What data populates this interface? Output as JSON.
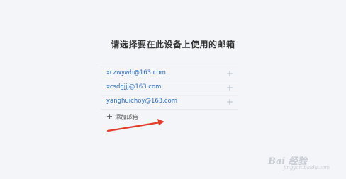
{
  "title": "请选择要在此设备上使用的邮箱",
  "accounts": [
    {
      "email": "xczwywh@163.com",
      "add_icon": "+"
    },
    {
      "email": "xcsdgjjj@163.com",
      "add_icon": "+"
    },
    {
      "email": "yanghuichoy@163.com",
      "add_icon": "+"
    }
  ],
  "add_mailbox": {
    "icon": "+",
    "label": "添加邮箱"
  },
  "watermark": {
    "text": "Bai 经验",
    "sub": "jingyan.baidu.com"
  },
  "colors": {
    "email": "#2a6db7",
    "arrow": "#e23b2e",
    "background": "#f3f5f9"
  }
}
